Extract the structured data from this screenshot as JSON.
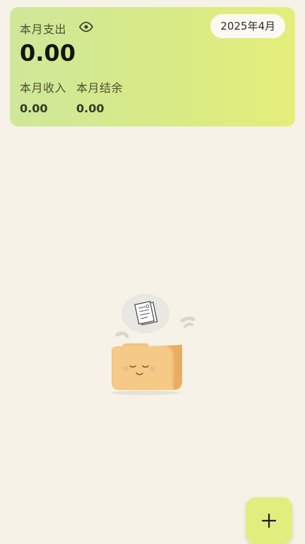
{
  "summary": {
    "expense_label": "本月支出",
    "expense_value": "0.00",
    "date_chip": "2025年4月",
    "income_label": "本月收入",
    "income_value": "0.00",
    "balance_label": "本月结余",
    "balance_value": "0.00",
    "visibility_icon": "eye-icon"
  },
  "empty_state": {
    "illustration": "empty-folder-illustration"
  },
  "fab": {
    "icon": "plus-icon"
  },
  "colors": {
    "background": "#f6f2e8",
    "card_gradient_start": "#cfe79a",
    "card_gradient_end": "#e4ee79",
    "fab": "#e1ee7e"
  }
}
